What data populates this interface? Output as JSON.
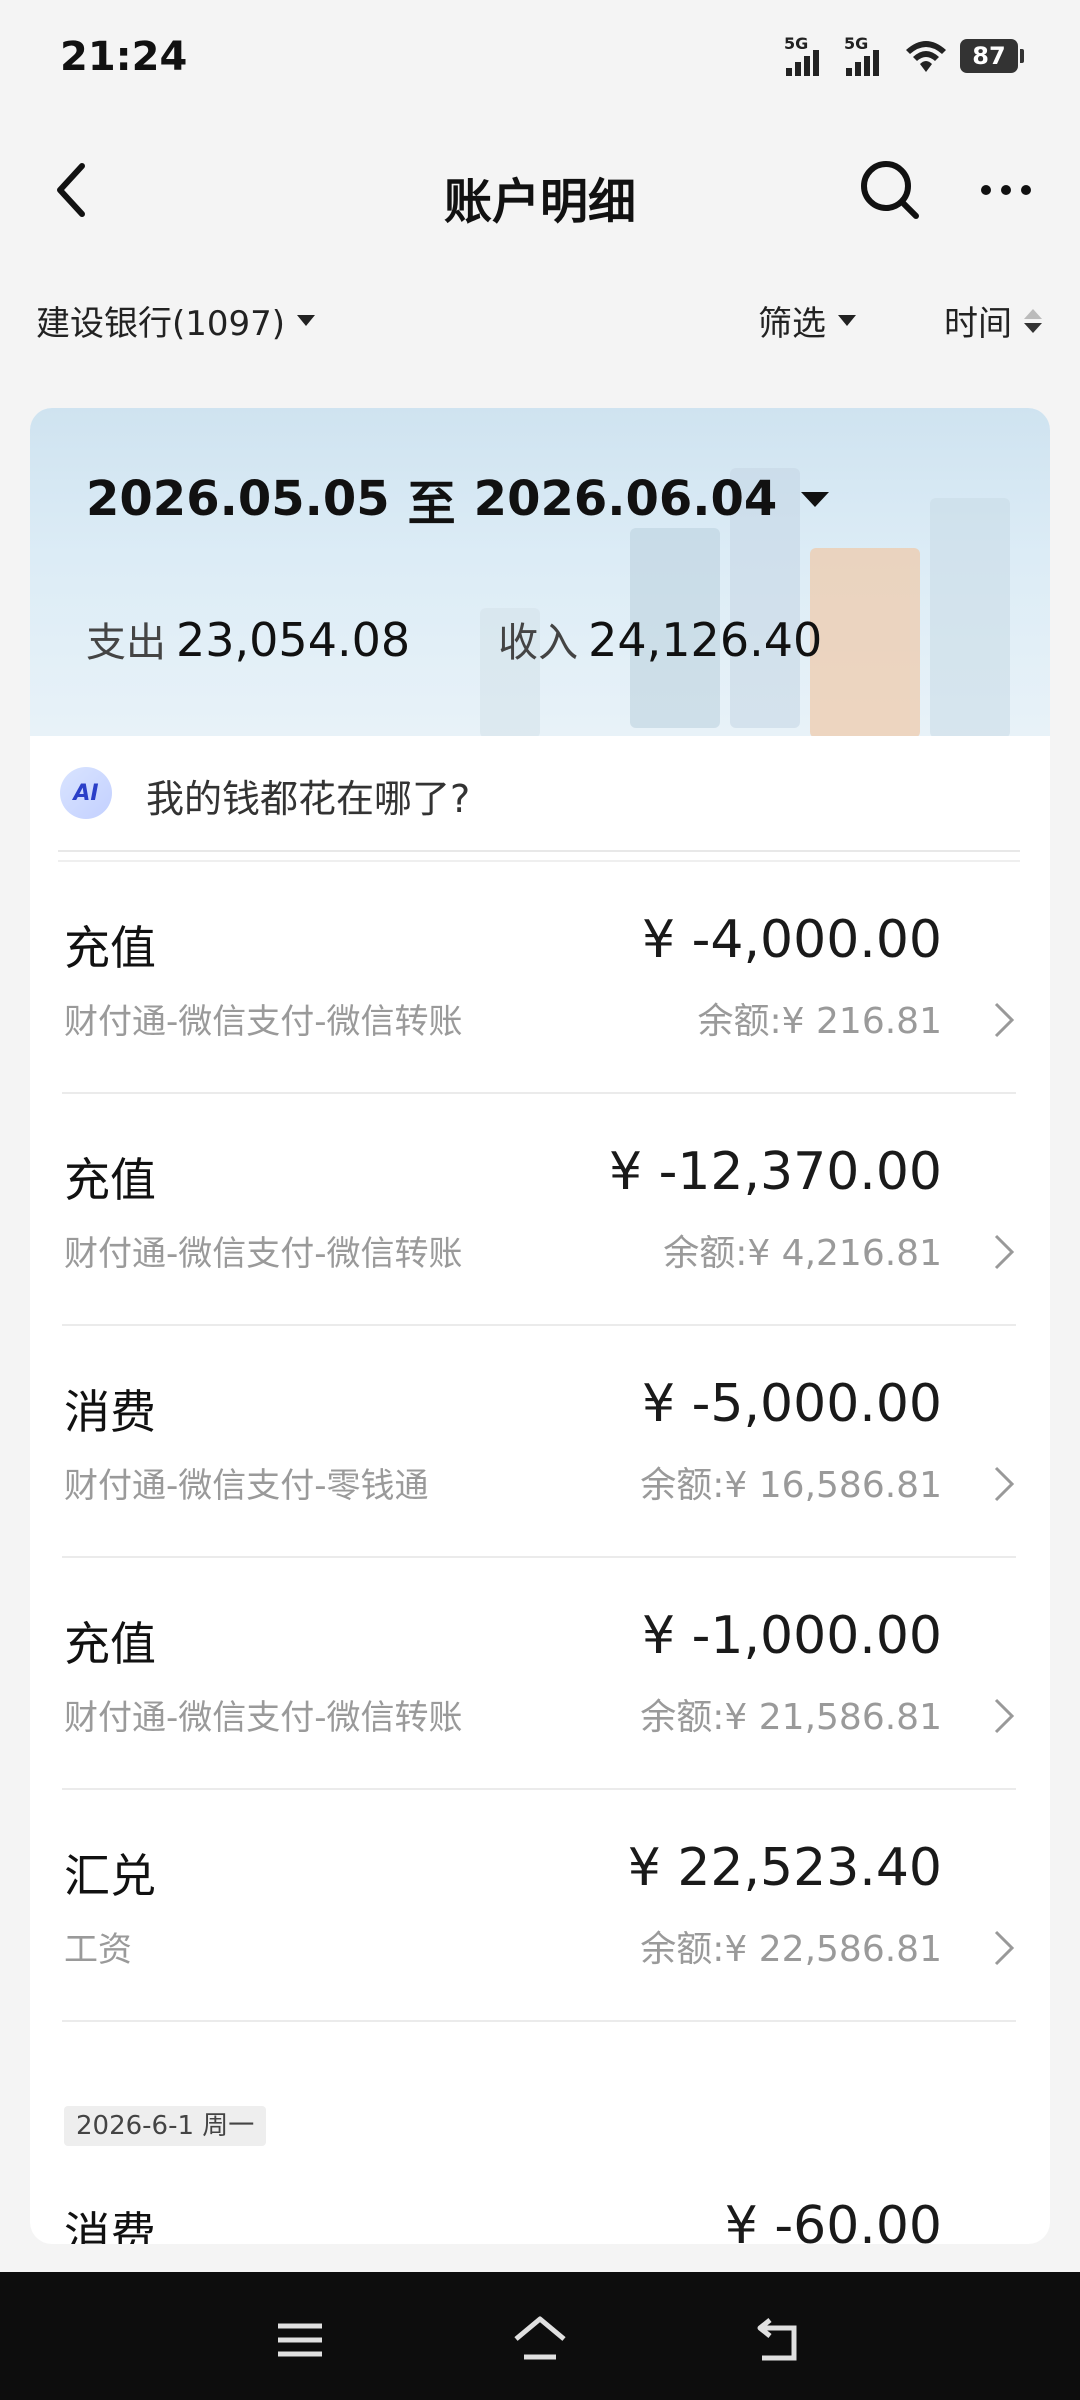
{
  "status_bar": {
    "time": "21:24",
    "signal1_label": "5G",
    "signal2_label": "5G",
    "battery": "87",
    "icons": [
      "signal-icon",
      "signal-icon",
      "wifi-icon",
      "battery-icon"
    ]
  },
  "nav": {
    "title": "账户明细",
    "icons": [
      "back-arrow-icon",
      "search-icon",
      "more-icon"
    ]
  },
  "filters": {
    "account": "建设银行(1097)",
    "filter_label": "筛选",
    "sort_label": "时间"
  },
  "summary": {
    "date_range_start": "2026.05.05",
    "date_range_sep": "至",
    "date_range_end": "2026.06.04",
    "expense_label": "支出",
    "expense_value": "23,054.08",
    "income_label": "收入",
    "income_value": "24,126.40"
  },
  "ai": {
    "badge": "AI",
    "prompt": "我的钱都花在哪了?"
  },
  "transactions": [
    {
      "type": "充值",
      "desc": "财付通-微信支付-微信转账",
      "amount": "¥ -4,000.00",
      "balance": "余额:¥ 216.81"
    },
    {
      "type": "充值",
      "desc": "财付通-微信支付-微信转账",
      "amount": "¥ -12,370.00",
      "balance": "余额:¥ 4,216.81"
    },
    {
      "type": "消费",
      "desc": "财付通-微信支付-零钱通",
      "amount": "¥ -5,000.00",
      "balance": "余额:¥ 16,586.81"
    },
    {
      "type": "充值",
      "desc": "财付通-微信支付-微信转账",
      "amount": "¥ -1,000.00",
      "balance": "余额:¥ 21,586.81"
    },
    {
      "type": "汇兑",
      "desc": "工资",
      "amount": "¥ 22,523.40",
      "balance": "余额:¥ 22,586.81"
    }
  ],
  "date_group": "2026-6-1 周一",
  "partial_tx": {
    "type": "消费",
    "amount": "¥ -60.00"
  },
  "system_nav": [
    "menu-icon",
    "home-icon",
    "back-icon"
  ]
}
